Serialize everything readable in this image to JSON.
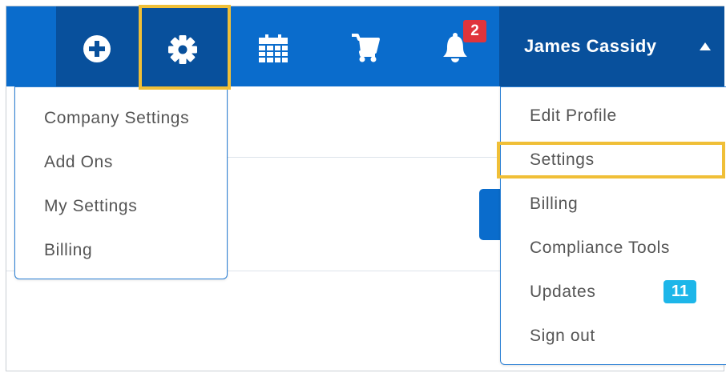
{
  "header": {
    "user_name": "James Cassidy",
    "notification_count": "2",
    "icons": [
      "plus-circle-icon",
      "gear-icon",
      "calendar-icon",
      "cart-icon",
      "bell-icon",
      "caret-up-icon"
    ]
  },
  "settings_menu": {
    "items": [
      "Company Settings",
      "Add Ons",
      "My Settings",
      "Billing"
    ]
  },
  "user_menu": {
    "items": [
      "Edit Profile",
      "Settings",
      "Billing",
      "Compliance Tools",
      "Updates",
      "Sign out"
    ],
    "updates_count": "11"
  },
  "colors": {
    "topbar": "#0a6ccc",
    "topbar_active": "#08509c",
    "highlight": "#f0bf37",
    "badge_red": "#e0343c",
    "badge_blue": "#1db6e9"
  }
}
